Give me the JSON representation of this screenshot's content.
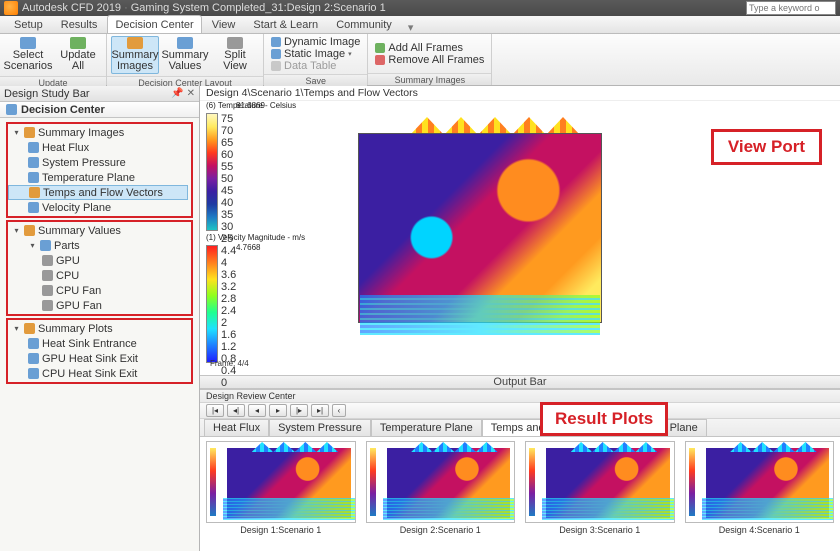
{
  "titlebar": {
    "product": "Autodesk CFD 2019",
    "file": "Gaming System Completed_31:Design 2:Scenario 1",
    "search_placeholder": "Type a keyword o"
  },
  "ribbon_tabs": [
    "Setup",
    "Results",
    "Decision Center",
    "View",
    "Start & Learn",
    "Community"
  ],
  "ribbon_active_tab": 2,
  "ribbon": {
    "update": {
      "label": "Update",
      "select_scenarios": "Select\nScenarios",
      "update_all": "Update\nAll"
    },
    "layout": {
      "label": "Decision Center Layout",
      "summary_images": "Summary\nImages",
      "summary_values": "Summary\nValues",
      "split_view": "Split\nView"
    },
    "save": {
      "label": "Save",
      "dynamic_image": "Dynamic Image",
      "static_image": "Static Image",
      "data_table": "Data Table"
    },
    "frames": {
      "label": "Summary Images",
      "add_all": "Add All Frames",
      "remove_all": "Remove All Frames"
    }
  },
  "dsb": {
    "bar_title": "Design Study Bar",
    "root": "Decision Center",
    "summary_images": {
      "label": "Summary Images",
      "items": [
        "Heat Flux",
        "System Pressure",
        "Temperature Plane",
        "Temps and Flow Vectors",
        "Velocity Plane"
      ],
      "selected": 3
    },
    "summary_values": {
      "label": "Summary Values",
      "parts_label": "Parts",
      "parts": [
        "GPU",
        "CPU",
        "CPU Fan",
        "GPU Fan"
      ]
    },
    "summary_plots": {
      "label": "Summary Plots",
      "items": [
        "Heat Sink Entrance",
        "GPU Heat Sink Exit",
        "CPU Heat Sink Exit"
      ]
    }
  },
  "viewport": {
    "title": "Design 4\\Scenario 1\\Temps and Flow Vectors",
    "annotation": "View Port",
    "temp_legend": {
      "title": "(6) Temperature - Celsius",
      "max": "81.6869",
      "ticks": [
        "75",
        "70",
        "65",
        "60",
        "55",
        "50",
        "45",
        "40",
        "35",
        "30",
        "25"
      ]
    },
    "vel_legend": {
      "title": "(1) Velocity Magnitude - m/s",
      "max": "4.7668",
      "ticks": [
        "4.4",
        "4",
        "3.6",
        "3.2",
        "2.8",
        "2.4",
        "2",
        "1.6",
        "1.2",
        "0.8",
        "0.4",
        "0"
      ]
    },
    "frame": "Frame: 4/4"
  },
  "output_bar": "Output Bar",
  "drc": {
    "title": "Design Review Center",
    "annotation": "Result Plots",
    "tabs": [
      "Heat Flux",
      "System Pressure",
      "Temperature Plane",
      "Temps and Flow Vectors",
      "Velocity Plane"
    ],
    "active_tab": 3,
    "thumbs": [
      "Design 1:Scenario 1",
      "Design 2:Scenario 1",
      "Design 3:Scenario 1",
      "Design 4:Scenario 1"
    ]
  }
}
